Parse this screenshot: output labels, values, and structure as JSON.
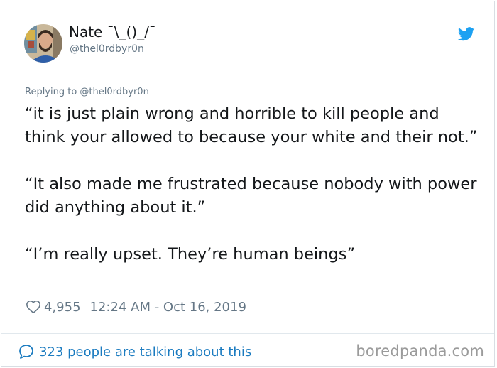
{
  "tweet": {
    "author_name": "Nate ¯\\_()_/¯",
    "author_handle": "@thel0rdbyr0n",
    "replying_to": "Replying to @thel0rdbyr0n",
    "paragraphs": [
      "“it is just plain wrong and horrible to kill people and think your allowed to because your white and their not.”",
      "“It also made me frustrated because nobody with power did anything about it.”",
      "“I’m really upset. They’re human beings”"
    ],
    "likes": "4,955",
    "timestamp": "12:24 AM - Oct 16, 2019",
    "talking_about": "323 people are talking about this"
  },
  "icons": {
    "brand": "twitter-bird-icon",
    "like": "heart-outline-icon",
    "reply": "speech-bubble-icon"
  },
  "watermark": "boredpanda.com",
  "colors": {
    "twitter_blue": "#1da1f2",
    "link_blue": "#1b7bc0",
    "secondary_text": "#657786",
    "primary_text": "#14171a",
    "watermark": "#9b9b9b"
  }
}
